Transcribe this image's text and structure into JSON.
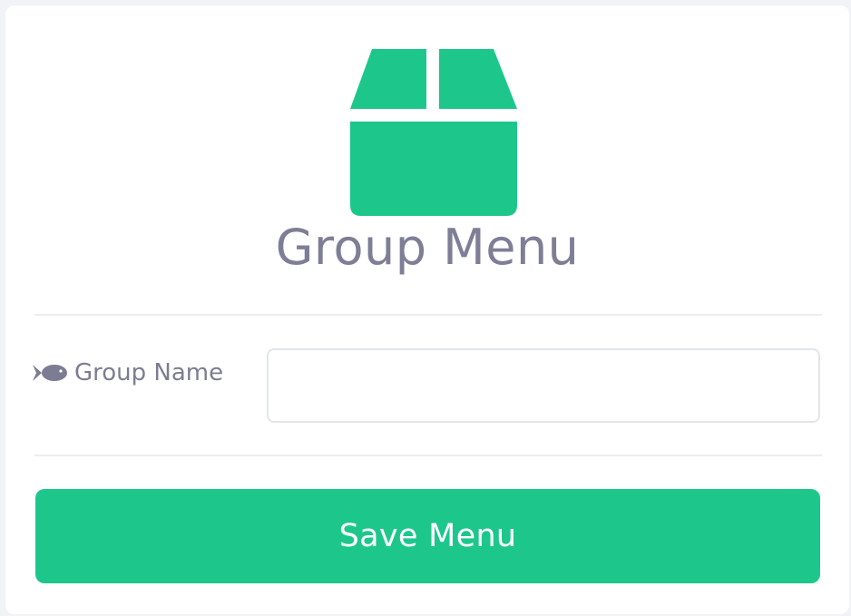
{
  "header": {
    "icon": "box-icon",
    "title": "Group Menu"
  },
  "form": {
    "group_name": {
      "icon": "fish-icon",
      "label": "Group Name",
      "value": "",
      "placeholder": ""
    }
  },
  "actions": {
    "save_label": "Save Menu"
  },
  "colors": {
    "accent": "#1DC78C",
    "text_muted": "#7E7E96",
    "background": "#F2F3F7",
    "card": "#FFFFFF"
  }
}
